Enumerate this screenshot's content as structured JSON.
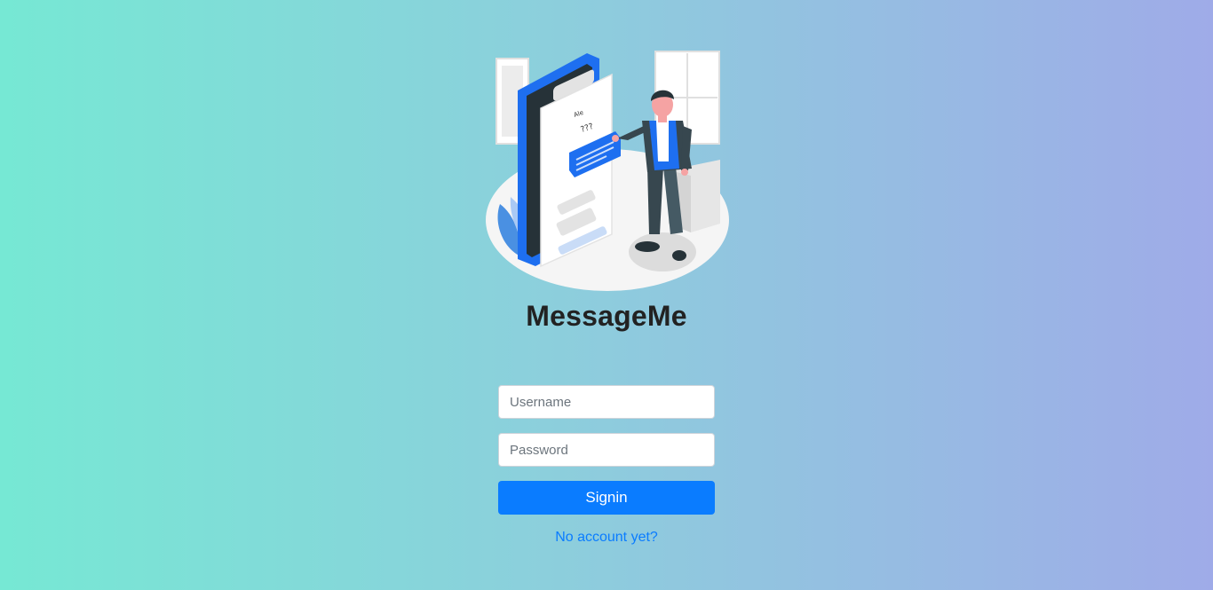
{
  "brand": {
    "title": "MessageMe"
  },
  "illustration": {
    "icon": "person-chatting-on-phone-illustration",
    "bubble_text": "???",
    "contact_name": "Ale"
  },
  "login": {
    "username_placeholder": "Username",
    "password_placeholder": "Password",
    "signin_label": "Signin",
    "signup_link": "No account yet?"
  },
  "colors": {
    "primary": "#0a7cff",
    "background_left": "#76e8d4",
    "background_right": "#9fabe8",
    "title": "#222222"
  }
}
